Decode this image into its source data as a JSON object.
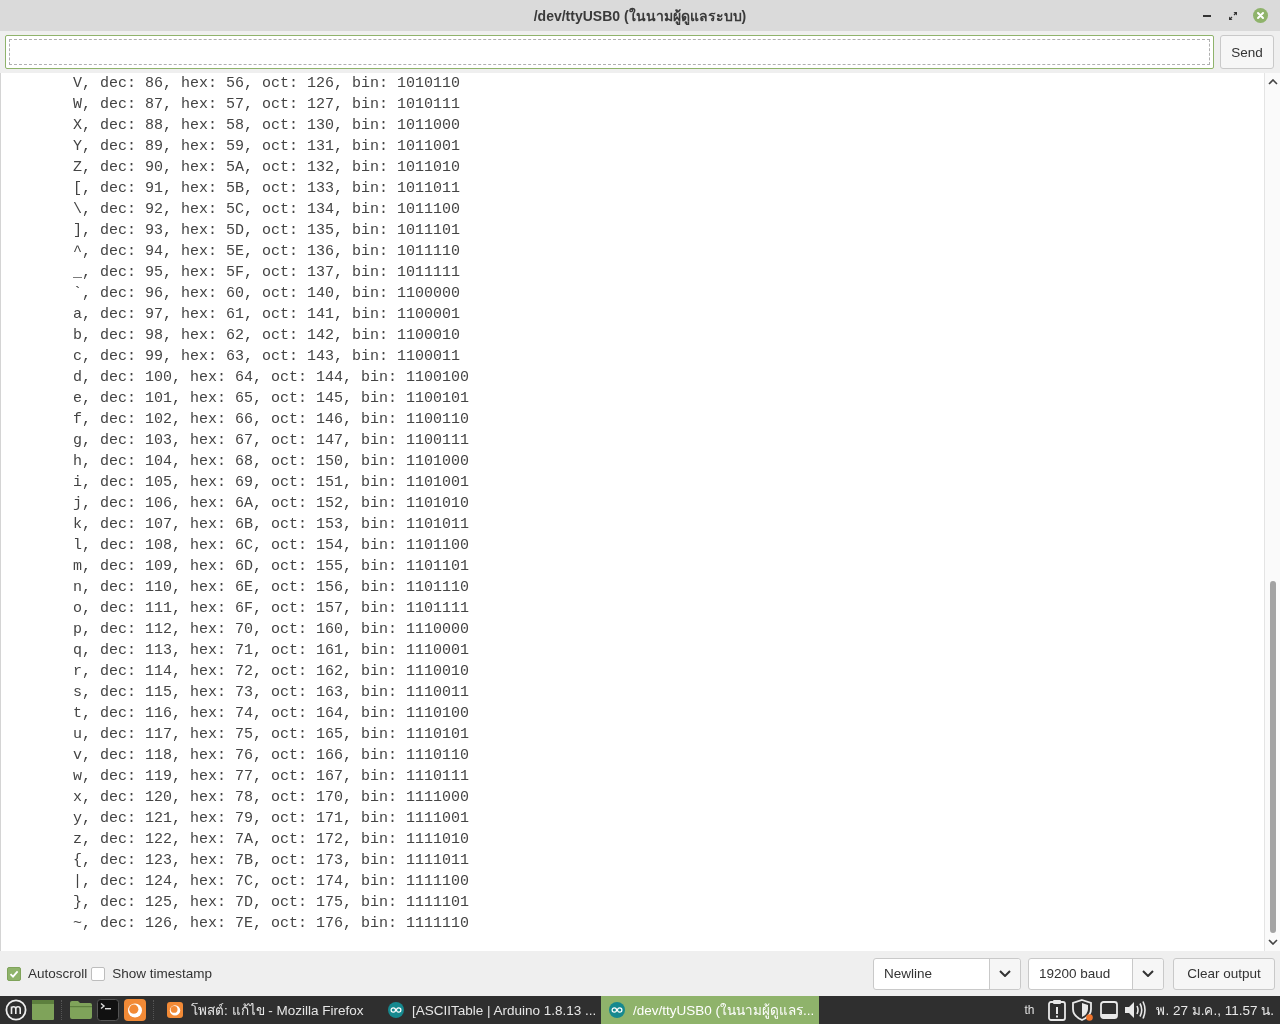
{
  "window": {
    "title": "/dev/ttyUSB0 (ในนามผู้ดูแลระบบ)"
  },
  "send_bar": {
    "button": "Send"
  },
  "output": {
    "lines": [
      "V, dec: 86, hex: 56, oct: 126, bin: 1010110",
      "W, dec: 87, hex: 57, oct: 127, bin: 1010111",
      "X, dec: 88, hex: 58, oct: 130, bin: 1011000",
      "Y, dec: 89, hex: 59, oct: 131, bin: 1011001",
      "Z, dec: 90, hex: 5A, oct: 132, bin: 1011010",
      "[, dec: 91, hex: 5B, oct: 133, bin: 1011011",
      "\\, dec: 92, hex: 5C, oct: 134, bin: 1011100",
      "], dec: 93, hex: 5D, oct: 135, bin: 1011101",
      "^, dec: 94, hex: 5E, oct: 136, bin: 1011110",
      "_, dec: 95, hex: 5F, oct: 137, bin: 1011111",
      "`, dec: 96, hex: 60, oct: 140, bin: 1100000",
      "a, dec: 97, hex: 61, oct: 141, bin: 1100001",
      "b, dec: 98, hex: 62, oct: 142, bin: 1100010",
      "c, dec: 99, hex: 63, oct: 143, bin: 1100011",
      "d, dec: 100, hex: 64, oct: 144, bin: 1100100",
      "e, dec: 101, hex: 65, oct: 145, bin: 1100101",
      "f, dec: 102, hex: 66, oct: 146, bin: 1100110",
      "g, dec: 103, hex: 67, oct: 147, bin: 1100111",
      "h, dec: 104, hex: 68, oct: 150, bin: 1101000",
      "i, dec: 105, hex: 69, oct: 151, bin: 1101001",
      "j, dec: 106, hex: 6A, oct: 152, bin: 1101010",
      "k, dec: 107, hex: 6B, oct: 153, bin: 1101011",
      "l, dec: 108, hex: 6C, oct: 154, bin: 1101100",
      "m, dec: 109, hex: 6D, oct: 155, bin: 1101101",
      "n, dec: 110, hex: 6E, oct: 156, bin: 1101110",
      "o, dec: 111, hex: 6F, oct: 157, bin: 1101111",
      "p, dec: 112, hex: 70, oct: 160, bin: 1110000",
      "q, dec: 113, hex: 71, oct: 161, bin: 1110001",
      "r, dec: 114, hex: 72, oct: 162, bin: 1110010",
      "s, dec: 115, hex: 73, oct: 163, bin: 1110011",
      "t, dec: 116, hex: 74, oct: 164, bin: 1110100",
      "u, dec: 117, hex: 75, oct: 165, bin: 1110101",
      "v, dec: 118, hex: 76, oct: 166, bin: 1110110",
      "w, dec: 119, hex: 77, oct: 167, bin: 1110111",
      "x, dec: 120, hex: 78, oct: 170, bin: 1111000",
      "y, dec: 121, hex: 79, oct: 171, bin: 1111001",
      "z, dec: 122, hex: 7A, oct: 172, bin: 1111010",
      "{, dec: 123, hex: 7B, oct: 173, bin: 1111011",
      "|, dec: 124, hex: 7C, oct: 174, bin: 1111100",
      "}, dec: 125, hex: 7D, oct: 175, bin: 1111101",
      "~, dec: 126, hex: 7E, oct: 176, bin: 1111110"
    ]
  },
  "options": {
    "checkboxes": [
      {
        "label": "Autoscroll",
        "checked": true
      },
      {
        "label": "Show timestamp",
        "checked": false
      }
    ],
    "line_ending": {
      "value": "Newline"
    },
    "baud_rate": {
      "value": "19200 baud"
    },
    "clear_button": "Clear output"
  },
  "taskbar": {
    "windows": [
      {
        "title": "โพสต์: แก้ไข - Mozilla Firefox",
        "kind": "firefox",
        "selected": false
      },
      {
        "title": "[ASCIITable | Arduino 1.8.13 ...",
        "kind": "arduino",
        "selected": false
      },
      {
        "title": "/dev/ttyUSB0 (ในนามผู้ดูแลร...",
        "kind": "arduino",
        "selected": true
      }
    ],
    "keyboard_layout": "th",
    "clock": "พ. 27 ม.ค., 11.57 น."
  }
}
